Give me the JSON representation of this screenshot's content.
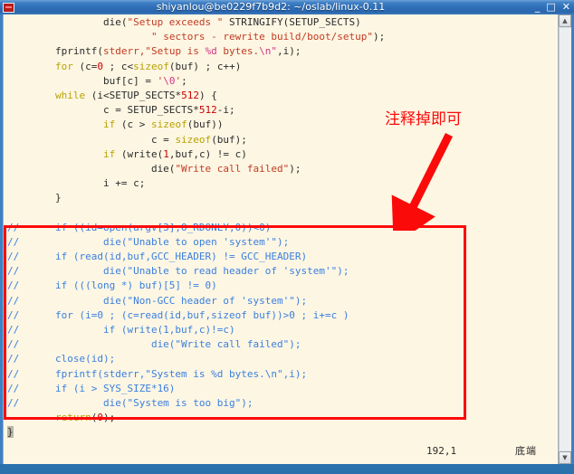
{
  "window": {
    "title": "shiyanlou@be0229f7b9d2: ~/oslab/linux-0.11",
    "icon": "terminal-icon",
    "minimize_label": "_",
    "maximize_label": "□",
    "close_label": "✕"
  },
  "editor": {
    "app": "vim",
    "lines": [
      [
        {
          "t": "                die(",
          "c": "s-txt"
        },
        {
          "t": "\"Setup exceeds \"",
          "c": "s-str"
        },
        {
          "t": " STRINGIFY(SETUP_SECTS)",
          "c": "s-txt"
        }
      ],
      [
        {
          "t": "                        ",
          "c": "s-txt"
        },
        {
          "t": "\" sectors - rewrite build/boot/setup\"",
          "c": "s-str"
        },
        {
          "t": ");",
          "c": "s-txt"
        }
      ],
      [
        {
          "t": "        fprintf(",
          "c": "s-txt"
        },
        {
          "t": "stderr,",
          "c": "s-str"
        },
        {
          "t": "\"Setup is ",
          "c": "s-str"
        },
        {
          "t": "%d",
          "c": "s-spc"
        },
        {
          "t": " bytes.",
          "c": "s-str"
        },
        {
          "t": "\\n\"",
          "c": "s-spc"
        },
        {
          "t": ",i);",
          "c": "s-txt"
        }
      ],
      [
        {
          "t": "        ",
          "c": "s-txt"
        },
        {
          "t": "for",
          "c": "s-kw"
        },
        {
          "t": " (c=",
          "c": "s-txt"
        },
        {
          "t": "0",
          "c": "s-num"
        },
        {
          "t": " ; c<",
          "c": "s-txt"
        },
        {
          "t": "sizeof",
          "c": "s-kw"
        },
        {
          "t": "(buf) ; c++)",
          "c": "s-txt"
        }
      ],
      [
        {
          "t": "                buf[c] = ",
          "c": "s-txt"
        },
        {
          "t": "'",
          "c": "s-str"
        },
        {
          "t": "\\0",
          "c": "s-spc"
        },
        {
          "t": "'",
          "c": "s-str"
        },
        {
          "t": ";",
          "c": "s-txt"
        }
      ],
      [
        {
          "t": "        ",
          "c": "s-txt"
        },
        {
          "t": "while",
          "c": "s-kw"
        },
        {
          "t": " (i<SETUP_SECTS*",
          "c": "s-txt"
        },
        {
          "t": "512",
          "c": "s-num"
        },
        {
          "t": ") {",
          "c": "s-txt"
        }
      ],
      [
        {
          "t": "                c = SETUP_SECTS*",
          "c": "s-txt"
        },
        {
          "t": "512",
          "c": "s-num"
        },
        {
          "t": "-i;",
          "c": "s-txt"
        }
      ],
      [
        {
          "t": "                ",
          "c": "s-txt"
        },
        {
          "t": "if",
          "c": "s-kw"
        },
        {
          "t": " (c > ",
          "c": "s-txt"
        },
        {
          "t": "sizeof",
          "c": "s-kw"
        },
        {
          "t": "(buf))",
          "c": "s-txt"
        }
      ],
      [
        {
          "t": "                        c = ",
          "c": "s-txt"
        },
        {
          "t": "sizeof",
          "c": "s-kw"
        },
        {
          "t": "(buf);",
          "c": "s-txt"
        }
      ],
      [
        {
          "t": "                ",
          "c": "s-txt"
        },
        {
          "t": "if",
          "c": "s-kw"
        },
        {
          "t": " (write(",
          "c": "s-txt"
        },
        {
          "t": "1",
          "c": "s-num"
        },
        {
          "t": ",buf,c) != c)",
          "c": "s-txt"
        }
      ],
      [
        {
          "t": "                        die(",
          "c": "s-txt"
        },
        {
          "t": "\"Write call failed\"",
          "c": "s-str"
        },
        {
          "t": ");",
          "c": "s-txt"
        }
      ],
      [
        {
          "t": "                i += c;",
          "c": "s-txt"
        }
      ],
      [
        {
          "t": "        }",
          "c": "s-txt"
        }
      ],
      [
        {
          "t": "",
          "c": "s-txt"
        }
      ],
      [
        {
          "t": "//      if ((id=open(argv[3],O_RDONLY,0))<0)",
          "c": "s-cmt"
        }
      ],
      [
        {
          "t": "//              die(\"Unable to open 'system'\");",
          "c": "s-cmt"
        }
      ],
      [
        {
          "t": "//      if (read(id,buf,GCC_HEADER) != GCC_HEADER)",
          "c": "s-cmt"
        }
      ],
      [
        {
          "t": "//              die(\"Unable to read header of 'system'\");",
          "c": "s-cmt"
        }
      ],
      [
        {
          "t": "//      if (((long *) buf)[5] != 0)",
          "c": "s-cmt"
        }
      ],
      [
        {
          "t": "//              die(\"Non-GCC header of 'system'\");",
          "c": "s-cmt"
        }
      ],
      [
        {
          "t": "//      for (i=0 ; (c=read(id,buf,sizeof buf))>0 ; i+=c )",
          "c": "s-cmt"
        }
      ],
      [
        {
          "t": "//              if (write(1,buf,c)!=c)",
          "c": "s-cmt"
        }
      ],
      [
        {
          "t": "//                      die(\"Write call failed\");",
          "c": "s-cmt"
        }
      ],
      [
        {
          "t": "//      close(id);",
          "c": "s-cmt"
        }
      ],
      [
        {
          "t": "//      fprintf(stderr,\"System is %d bytes.\\n\",i);",
          "c": "s-cmt"
        }
      ],
      [
        {
          "t": "//      if (i > SYS_SIZE*16)",
          "c": "s-cmt"
        }
      ],
      [
        {
          "t": "//              die(\"System is too big\");",
          "c": "s-cmt"
        }
      ],
      [
        {
          "t": "        ",
          "c": "s-txt"
        },
        {
          "t": "return",
          "c": "s-kw"
        },
        {
          "t": "(",
          "c": "s-txt"
        },
        {
          "t": "0",
          "c": "s-num"
        },
        {
          "t": ");",
          "c": "s-txt"
        }
      ],
      [
        {
          "t": "}",
          "c": "cursor"
        }
      ]
    ]
  },
  "statusline": {
    "ruler": "192,1",
    "position": "底端"
  },
  "annotations": {
    "note_text": "注释掉即可",
    "note_color": "#fb0a0a",
    "rect_color": "#fb0a0a",
    "arrow": "down-left-arrow"
  },
  "scrollbar": {
    "up_arrow": "▲",
    "down_arrow": "▼"
  }
}
